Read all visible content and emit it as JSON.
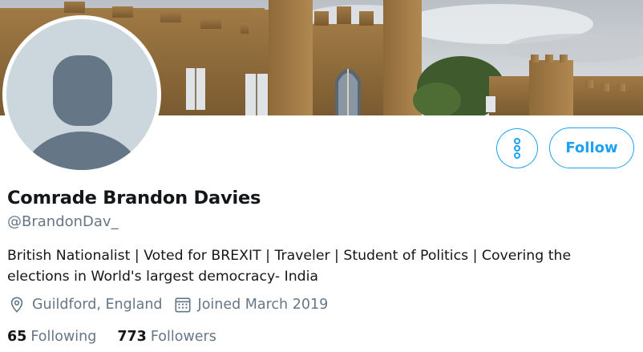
{
  "profile": {
    "name": "Comrade Brandon Davies",
    "handle": "@BrandonDav_",
    "bio": "British Nationalist | Voted for BREXIT | Traveler | Student of Politics | Covering the elections in World's largest democracy- India",
    "location": "Guildford, England",
    "joined": "Joined March 2019"
  },
  "stats": {
    "following_count": "65",
    "following_label": "Following",
    "followers_count": "773",
    "followers_label": "Followers"
  },
  "actions": {
    "follow_label": "Follow",
    "more_icon": "more-vertical-icon"
  },
  "icons": {
    "location": "location-pin-icon",
    "calendar": "calendar-icon"
  },
  "colors": {
    "accent": "#1da1f2",
    "secondary_text": "#657786",
    "avatar_bg": "#ccd6dd",
    "avatar_figure": "#657786"
  }
}
